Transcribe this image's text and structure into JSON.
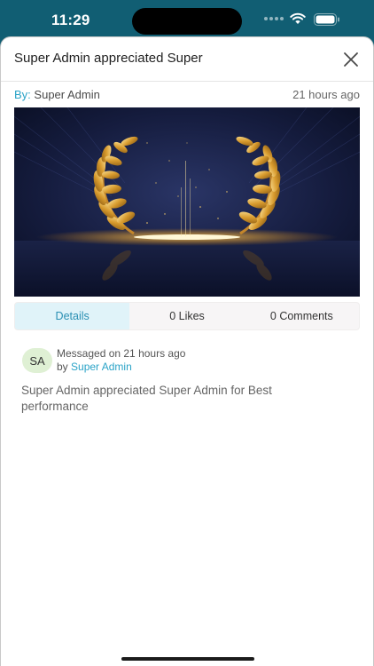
{
  "status_bar": {
    "time": "11:29"
  },
  "sheet": {
    "title": "Super Admin appreciated Super",
    "by_label": "By:",
    "by_name": "Super Admin",
    "time_ago": "21 hours ago"
  },
  "tabs": [
    {
      "label": "Details",
      "active": true
    },
    {
      "label": "0 Likes",
      "active": false
    },
    {
      "label": "0 Comments",
      "active": false
    }
  ],
  "message": {
    "avatar_initials": "SA",
    "prefix": "Messaged on 21 hours ago",
    "by_prefix": "by",
    "author": "Super Admin",
    "body": "Super Admin appreciated Super Admin for Best performance"
  },
  "colors": {
    "header_bg": "#115e73",
    "accent": "#2aa3c7",
    "active_tab_bg": "#e0f3f9",
    "avatar_bg": "#dff0d4"
  },
  "icons": {
    "close": "close-icon",
    "wifi": "wifi-icon",
    "battery": "battery-icon",
    "signal": "signal-icon"
  }
}
